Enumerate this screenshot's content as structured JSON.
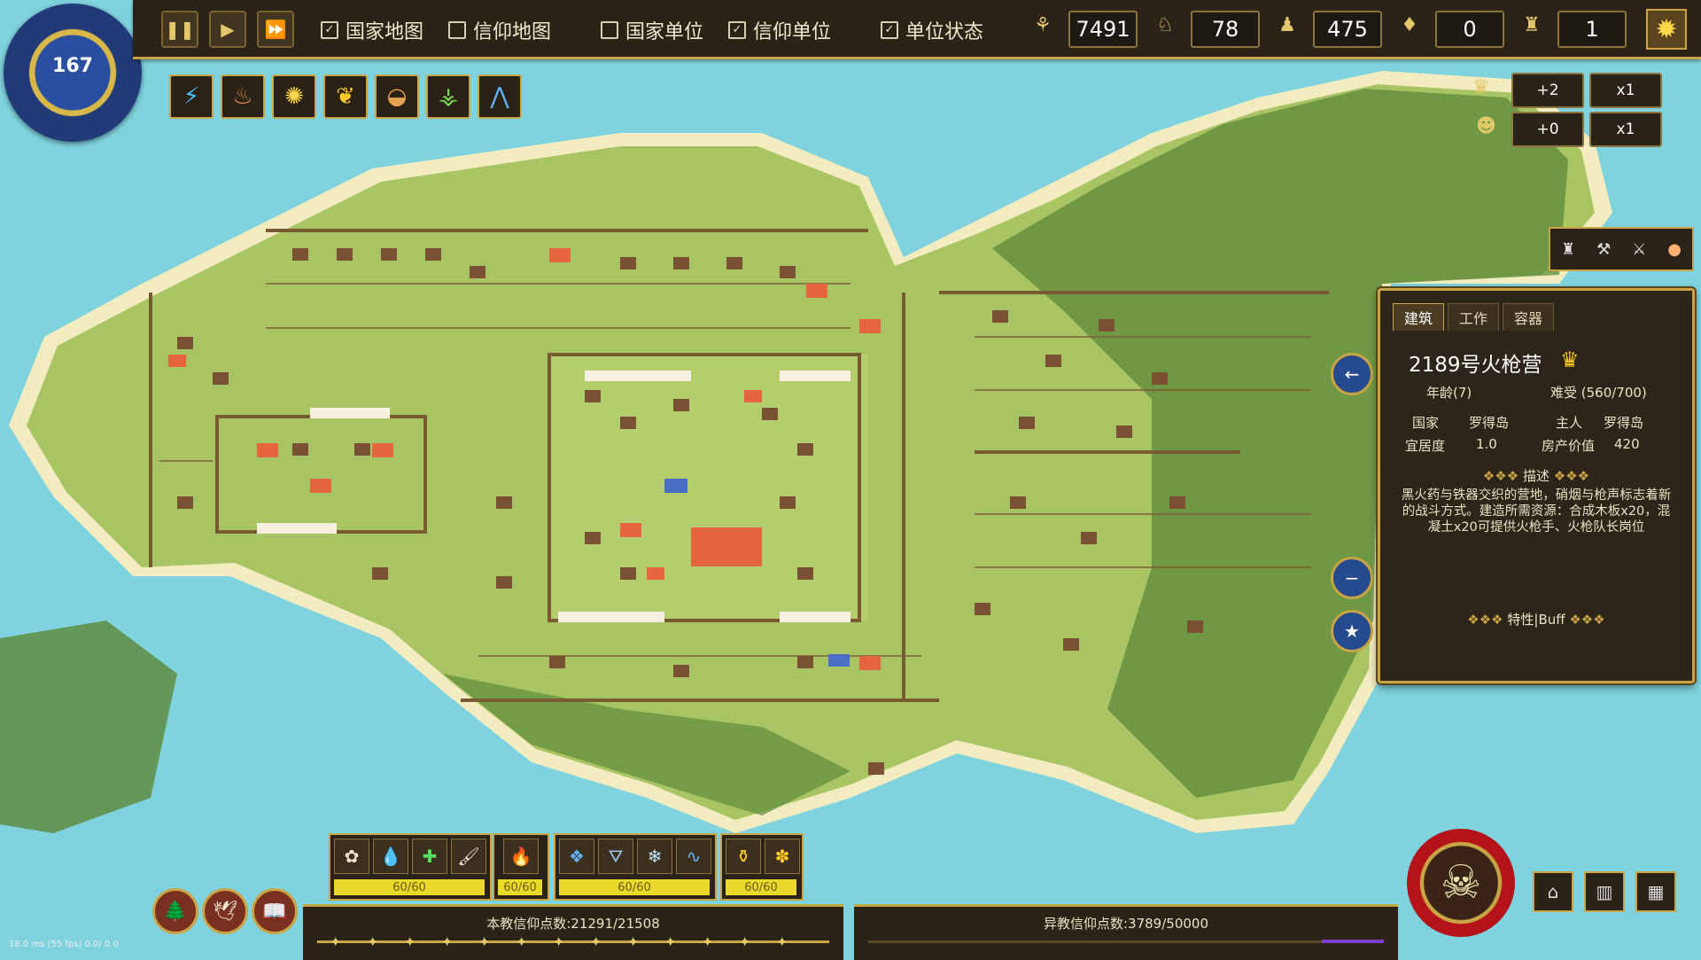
{
  "hud": {
    "day_counter": "167",
    "controls": [
      {
        "name": "pause-button",
        "glyph": "❚❚"
      },
      {
        "name": "play-button",
        "glyph": "▶"
      },
      {
        "name": "fast-forward-button",
        "glyph": "⏩"
      }
    ],
    "toggles": [
      {
        "name": "toggle-nation-map",
        "label": "国家地图",
        "checked": true
      },
      {
        "name": "toggle-faith-map",
        "label": "信仰地图",
        "checked": false
      },
      {
        "name": "toggle-nation-units",
        "label": "国家单位",
        "checked": false
      },
      {
        "name": "toggle-faith-units",
        "label": "信仰单位",
        "checked": true
      },
      {
        "name": "toggle-unit-status",
        "label": "单位状态",
        "checked": true
      }
    ],
    "resources": [
      {
        "name": "wheat",
        "icon": "wheat-icon",
        "glyph": "⚘",
        "value": "7491"
      },
      {
        "name": "rabbit",
        "icon": "rabbit-icon",
        "glyph": "♘",
        "value": "78"
      },
      {
        "name": "population",
        "icon": "person-icon",
        "glyph": "♟",
        "value": "475"
      },
      {
        "name": "faith",
        "icon": "drop-icon",
        "glyph": "♦",
        "value": "0"
      },
      {
        "name": "soldier",
        "icon": "soldier-icon",
        "glyph": "♜",
        "value": "1"
      }
    ],
    "settings_icon": "sun-icon"
  },
  "powers": [
    {
      "name": "power-lightning",
      "glyph": "⚡",
      "color": "#4fc3ff"
    },
    {
      "name": "power-harvest",
      "glyph": "♨",
      "color": "#e08a3a"
    },
    {
      "name": "power-sun-wheel",
      "glyph": "✺",
      "color": "#ffd84a"
    },
    {
      "name": "power-corn",
      "glyph": "❦",
      "color": "#ffc927"
    },
    {
      "name": "power-bread",
      "glyph": "◒",
      "color": "#e3a050"
    },
    {
      "name": "power-growth",
      "glyph": "⚶",
      "color": "#7ed957"
    },
    {
      "name": "power-compass",
      "glyph": "⋀",
      "color": "#5fb0ff"
    }
  ],
  "speed": [
    {
      "name": "production-bonus",
      "glyph": "♛",
      "value": "+2",
      "mult": "x1"
    },
    {
      "name": "faith-bonus",
      "glyph": "☻",
      "value": "+0",
      "mult": "x1"
    }
  ],
  "panel": {
    "tabs": [
      "建筑",
      "工作",
      "容器"
    ],
    "active_tab": 0,
    "title": "2189号火枪营",
    "age": "年龄(7)",
    "difficulty": "难受 (560/700)",
    "rows": [
      {
        "k1": "国家",
        "v1": "罗得岛",
        "k2": "主人",
        "v2": "罗得岛"
      },
      {
        "k1": "宜居度",
        "v1": "1.0",
        "k2": "房产价值",
        "v2": "420"
      }
    ],
    "desc_header": "描述",
    "description": "黑火药与铁器交织的营地，硝烟与枪声标志着新的战斗方式。建造所需资源：合成木板x20，混凝土x20可提供火枪手、火枪队长岗位",
    "traits_header": "特性|Buff"
  },
  "actions": {
    "group1": {
      "glyphs": [
        "✿",
        "💧",
        "✚",
        "🖌"
      ],
      "label": "60/60"
    },
    "group2": {
      "glyphs": [
        "🔥"
      ],
      "label": "60/60"
    },
    "group3": {
      "glyphs": [
        "❖",
        "⛛",
        "❄",
        "∿"
      ],
      "label": "60/60"
    },
    "group4": {
      "glyphs": [
        "⚱",
        "✽"
      ],
      "label": "60/60"
    }
  },
  "faith": {
    "own": "本教信仰点数:21291/21508",
    "other": "异教信仰点数:3789/50000"
  },
  "fps": "18.0 ms (55 fps) 0.0/ 0.0"
}
